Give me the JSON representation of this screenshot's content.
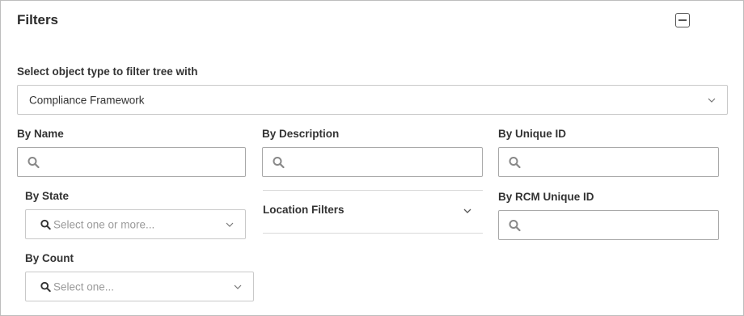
{
  "panel": {
    "title": "Filters"
  },
  "object_type": {
    "label": "Select object type to filter tree with",
    "value": "Compliance Framework"
  },
  "by_name": {
    "label": "By Name"
  },
  "by_description": {
    "label": "By Description"
  },
  "by_unique_id": {
    "label": "By Unique ID"
  },
  "by_state": {
    "label": "By State",
    "placeholder": "Select one or more..."
  },
  "location_filters": {
    "label": "Location Filters"
  },
  "by_rcm_unique_id": {
    "label": "By RCM Unique ID"
  },
  "by_count": {
    "label": "By Count",
    "placeholder": "Select one..."
  },
  "icons": {
    "search": "search-icon",
    "chevron": "chevron-down-icon",
    "collapse": "minus-square-icon"
  }
}
